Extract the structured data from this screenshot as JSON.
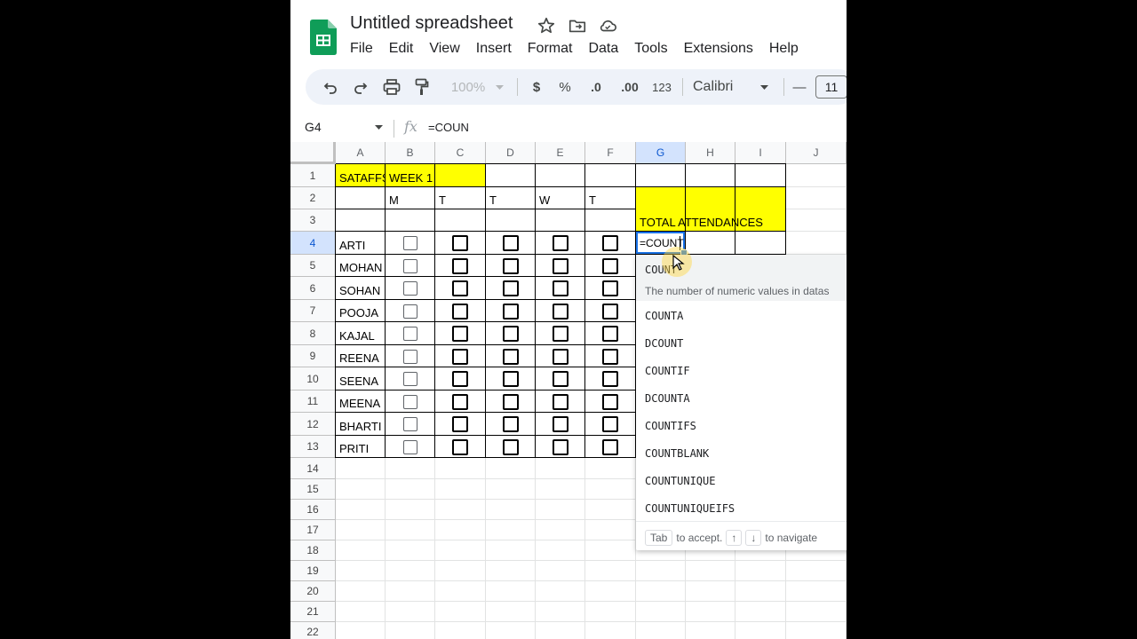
{
  "doc": {
    "title": "Untitled spreadsheet",
    "menu": [
      "File",
      "Edit",
      "View",
      "Insert",
      "Format",
      "Data",
      "Tools",
      "Extensions",
      "Help"
    ]
  },
  "toolbar": {
    "zoom": "100%",
    "currency": "$",
    "percent": "%",
    "dec_decrease": ".0",
    "dec_increase": ".00",
    "format_123": "123",
    "font": "Calibri",
    "font_size": "11",
    "minus": "—"
  },
  "formula_bar": {
    "name_box": "G4",
    "fx": "fx",
    "value": "=COUN"
  },
  "grid": {
    "columns": [
      "A",
      "B",
      "C",
      "D",
      "E",
      "F",
      "G",
      "H",
      "I",
      "J"
    ],
    "selected_column": "G",
    "rows": [
      "1",
      "2",
      "3",
      "4",
      "5",
      "6",
      "7",
      "8",
      "9",
      "10",
      "11",
      "12",
      "13",
      "14",
      "15",
      "16",
      "17",
      "18",
      "19",
      "20",
      "21",
      "22"
    ],
    "selected_row": "4",
    "cells": {
      "A1": "SATAFFS",
      "B1": "WEEK 1",
      "B2": "M",
      "C2": "T",
      "D2": "T",
      "E2": "W",
      "F2": "T",
      "G3": "TOTAL ATTENDANCES"
    },
    "names": [
      "ARTI",
      "MOHAN",
      "SOHAN",
      "POOJA",
      "KAJAL",
      "REENA",
      "SEENA",
      "MEENA",
      "BHARTI",
      "PRITI"
    ],
    "active_cell_text": "=COUNT"
  },
  "autocomplete": {
    "top": "COUNT",
    "description": "The number of numeric values in datas",
    "items": [
      "COUNTA",
      "DCOUNT",
      "COUNTIF",
      "DCOUNTA",
      "COUNTIFS",
      "COUNTBLANK",
      "COUNTUNIQUE",
      "COUNTUNIQUEIFS"
    ],
    "footer": {
      "tab_key": "Tab",
      "accept": "to accept.",
      "up": "↑",
      "down": "↓",
      "navigate": "to navigate"
    }
  },
  "colors": {
    "highlight": "#ffff00",
    "selection": "#1a73e8",
    "toolbar_bg": "#eef2f9"
  }
}
